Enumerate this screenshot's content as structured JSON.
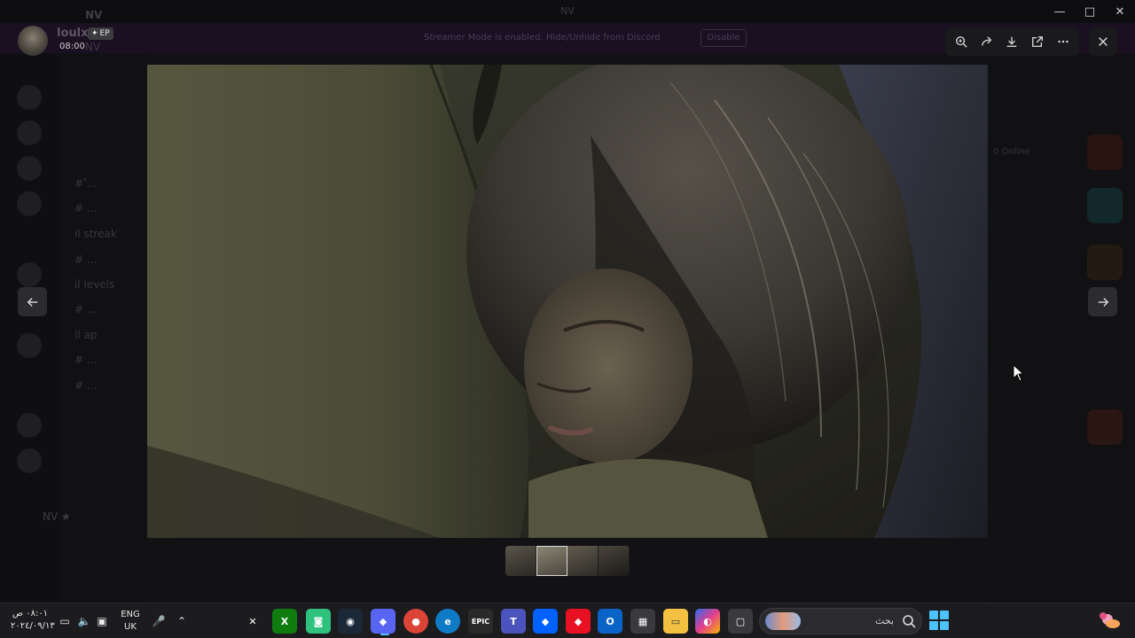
{
  "window": {
    "title": "NV"
  },
  "banner": {
    "text": "Streamer Mode is enabled. Hide/Unhide from Discord",
    "button": "Disable"
  },
  "server": {
    "name": "NV"
  },
  "channels": [
    {
      "label": "# ٌ..."
    },
    {
      "label": "# ..."
    },
    {
      "label": "il streak"
    },
    {
      "label": "# ..."
    },
    {
      "label": "il levels"
    },
    {
      "label": "# ..."
    },
    {
      "label": "il ap"
    },
    {
      "label": "# ..."
    },
    {
      "label": "# ..."
    }
  ],
  "bottom_user": {
    "name": "NV ★"
  },
  "right_panel": {
    "online": "0 Online"
  },
  "uploader": {
    "name": "loulx",
    "badge": "EP",
    "time": "08:00"
  },
  "toolbar": {
    "zoom": "zoom-in-icon",
    "forward": "forward-icon",
    "download": "download-icon",
    "open": "open-external-icon",
    "more": "more-icon",
    "close": "close-icon"
  },
  "thumbnails": [
    {
      "id": "thumb-1"
    },
    {
      "id": "thumb-2",
      "selected": true
    },
    {
      "id": "thumb-3"
    },
    {
      "id": "thumb-4"
    }
  ],
  "taskbar": {
    "clock_time": "٠٨:٠١ ص",
    "clock_date": "٢٠٢٤/٠٩/١٣",
    "lang_line1": "ENG",
    "lang_line2": "UK",
    "search_text": "بحث",
    "apps": [
      {
        "name": "Capcut",
        "label": "✕"
      },
      {
        "name": "Xbox",
        "label": "X"
      },
      {
        "name": "Discord-alt",
        "label": "◙"
      },
      {
        "name": "Steam",
        "label": "◉"
      },
      {
        "name": "Discord",
        "label": "◆"
      },
      {
        "name": "Chrome",
        "label": "●"
      },
      {
        "name": "Edge",
        "label": "e"
      },
      {
        "name": "Epic Games",
        "label": "EPIC"
      },
      {
        "name": "Teams",
        "label": "T"
      },
      {
        "name": "Dropbox",
        "label": "◆"
      },
      {
        "name": "App",
        "label": "◆"
      },
      {
        "name": "Outlook",
        "label": "O"
      },
      {
        "name": "Store",
        "label": "▦"
      },
      {
        "name": "Explorer",
        "label": "▭"
      },
      {
        "name": "Copilot",
        "label": "◐"
      },
      {
        "name": "Task view",
        "label": "▢"
      }
    ]
  },
  "colors": {
    "accent": "#4cc2ff",
    "overlay": "#1a1a1d"
  }
}
